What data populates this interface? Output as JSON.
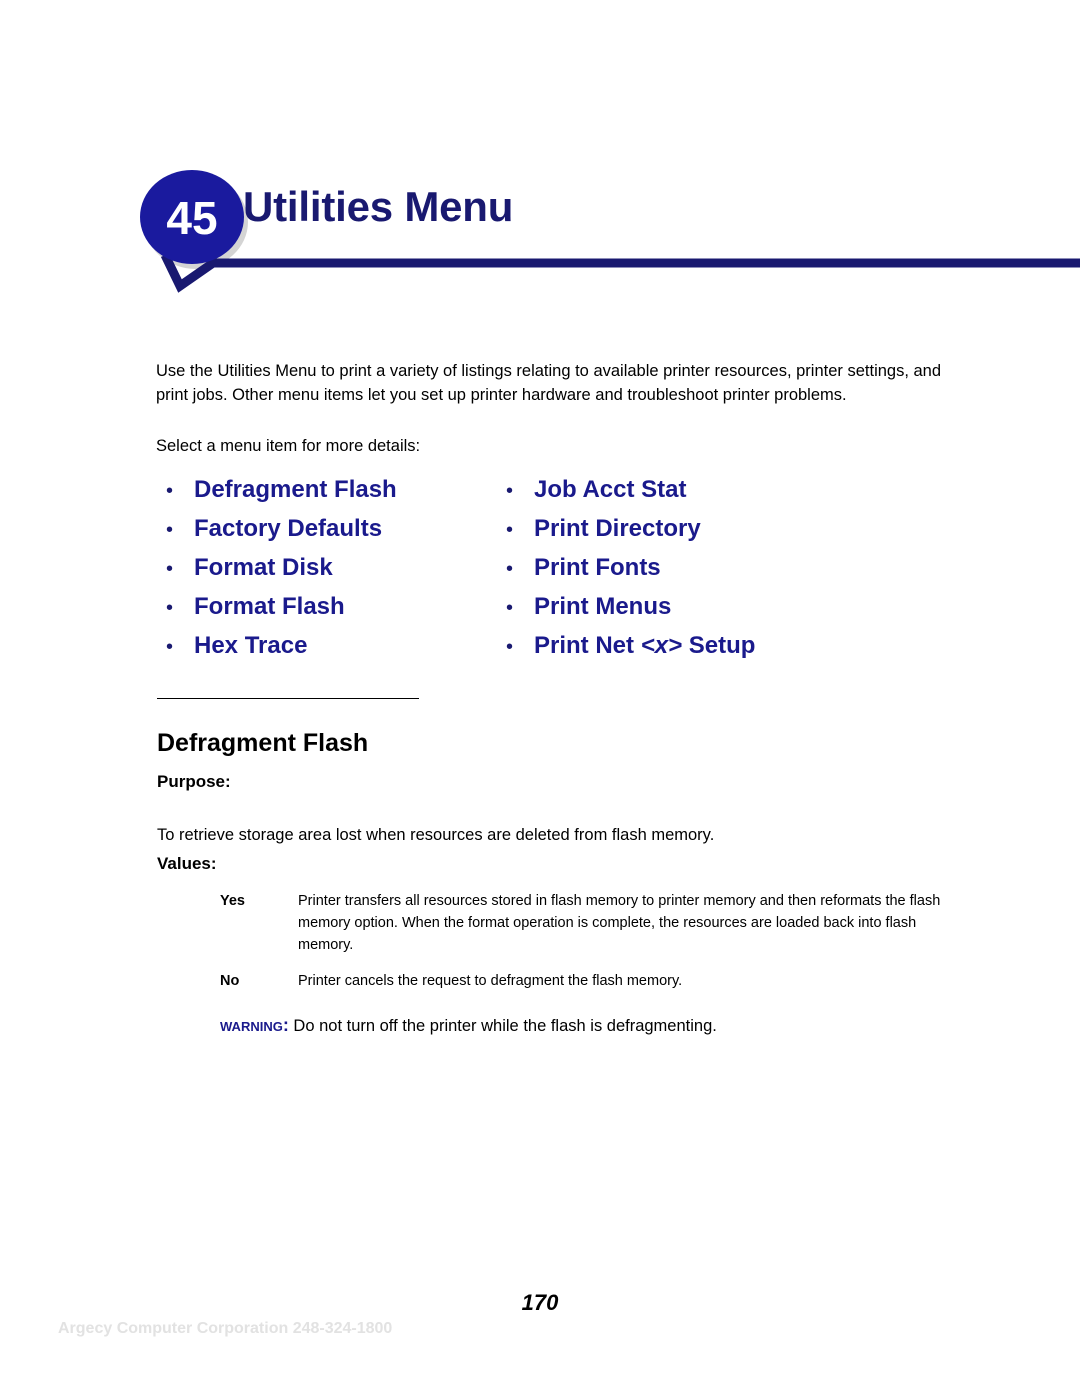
{
  "header": {
    "chapter_number": "45",
    "title": "Utilities Menu",
    "accent_color": "#191970",
    "badge_color": "#1a1a9e",
    "badge_shadow_color": "#d4d4d4"
  },
  "intro": {
    "paragraph": "Use the Utilities Menu to print a variety of listings relating to available printer resources, printer settings, and print jobs. Other menu items let you set up printer hardware and troubleshoot printer problems.",
    "prompt": "Select a menu item for more details:"
  },
  "menu_links": {
    "bullet": "•",
    "left_column": [
      {
        "label": "Defragment Flash"
      },
      {
        "label": "Factory Defaults"
      },
      {
        "label": "Format Disk"
      },
      {
        "label": "Format Flash"
      },
      {
        "label": "Hex Trace"
      }
    ],
    "right_column": [
      {
        "label": "Job Acct Stat"
      },
      {
        "label": "Print Directory"
      },
      {
        "label": "Print Fonts"
      },
      {
        "label": "Print Menus"
      },
      {
        "label": "Print Net ",
        "variable": "<x>",
        "label_suffix": " Setup"
      }
    ],
    "link_color": "#1a1a8c"
  },
  "section": {
    "heading": "Defragment Flash",
    "purpose_label": "Purpose:",
    "purpose_text": "To retrieve storage area lost when resources are deleted from flash memory.",
    "values_label": "Values:",
    "values": [
      {
        "name": "Yes",
        "description": "Printer transfers all resources stored in flash memory to printer memory and then reformats the flash memory option. When the format operation is complete, the resources are loaded back into flash memory."
      },
      {
        "name": "No",
        "description": "Printer cancels the request to defragment the flash memory."
      }
    ],
    "warning_word": "Warning:",
    "warning_text": " Do not turn off the printer while the flash is defragmenting.",
    "warning_color": "#1a1a8c"
  },
  "footer": {
    "page_number": "170",
    "watermark": "Argecy Computer Corporation 248-324-1800"
  }
}
